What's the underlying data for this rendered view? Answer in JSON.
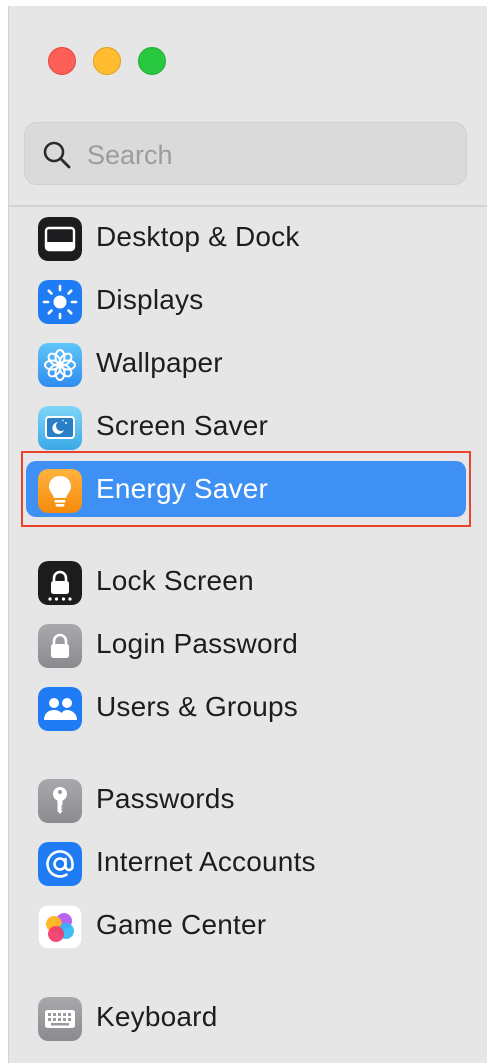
{
  "window": {
    "controls": [
      "close",
      "minimize",
      "zoom"
    ]
  },
  "search": {
    "placeholder": "Search",
    "value": ""
  },
  "sidebar": {
    "items": [
      {
        "label": "Desktop & Dock",
        "icon": "desktop-dock-icon"
      },
      {
        "label": "Displays",
        "icon": "displays-icon"
      },
      {
        "label": "Wallpaper",
        "icon": "wallpaper-icon"
      },
      {
        "label": "Screen Saver",
        "icon": "screen-saver-icon"
      },
      {
        "label": "Energy Saver",
        "icon": "energy-saver-icon",
        "selected": true
      },
      {
        "label": "Lock Screen",
        "icon": "lock-screen-icon"
      },
      {
        "label": "Login Password",
        "icon": "login-password-icon"
      },
      {
        "label": "Users & Groups",
        "icon": "users-groups-icon"
      },
      {
        "label": "Passwords",
        "icon": "passwords-icon"
      },
      {
        "label": "Internet Accounts",
        "icon": "internet-accounts-icon"
      },
      {
        "label": "Game Center",
        "icon": "game-center-icon"
      },
      {
        "label": "Keyboard",
        "icon": "keyboard-icon"
      }
    ]
  },
  "colors": {
    "selected_background": "#3f90f5",
    "highlight_outline": "#e8432c",
    "sidebar_background": "#e6e6e6"
  }
}
